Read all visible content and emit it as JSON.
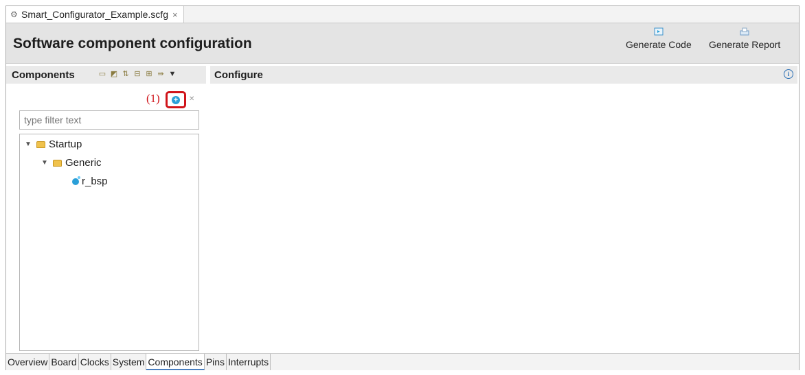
{
  "editor_tab": {
    "title": "Smart_Configurator_Example.scfg",
    "close_glyph": "×",
    "icon": "gear-icon"
  },
  "header": {
    "title": "Software component configuration",
    "generate_code_label": "Generate Code",
    "generate_report_label": "Generate Report"
  },
  "components_panel": {
    "title": "Components",
    "callout": "(1)",
    "filter_placeholder": "type filter text",
    "tree": [
      {
        "label": "Startup",
        "expanded": true,
        "icon": "folder-icon"
      },
      {
        "label": "Generic",
        "expanded": true,
        "icon": "folder-icon"
      },
      {
        "label": "r_bsp",
        "icon": "component-icon"
      }
    ]
  },
  "configure_panel": {
    "title": "Configure"
  },
  "bottom_tabs": [
    {
      "label": "Overview"
    },
    {
      "label": "Board"
    },
    {
      "label": "Clocks"
    },
    {
      "label": "System"
    },
    {
      "label": "Components",
      "active": true
    },
    {
      "label": "Pins"
    },
    {
      "label": "Interrupts"
    }
  ],
  "colors": {
    "callout_red": "#d0141a",
    "header_bg": "#e4e4e4",
    "accent_blue": "#2a9fd8"
  }
}
